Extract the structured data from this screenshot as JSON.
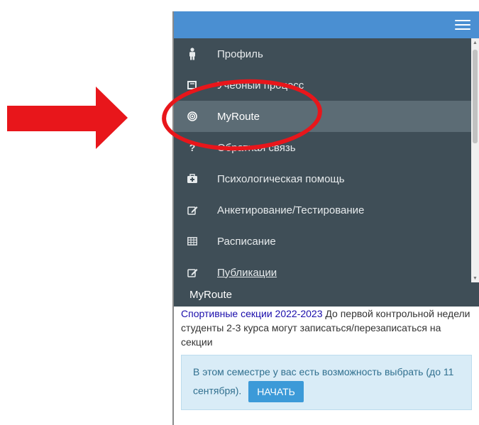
{
  "menu": {
    "items": [
      {
        "label": "Профиль",
        "icon": "person-icon",
        "active": false
      },
      {
        "label": "Учебный процесс",
        "icon": "book-icon",
        "active": false
      },
      {
        "label": "MyRoute",
        "icon": "target-icon",
        "active": true
      },
      {
        "label": "Обратная связь",
        "icon": "question-icon",
        "active": false
      },
      {
        "label": "Психологическая помощь",
        "icon": "medkit-icon",
        "active": false
      },
      {
        "label": "Анкетирование/Тестирование",
        "icon": "edit-icon",
        "active": false
      },
      {
        "label": "Расписание",
        "icon": "table-icon",
        "active": false
      },
      {
        "label": "Публикации",
        "icon": "edit-icon",
        "active": false
      }
    ]
  },
  "subheader": {
    "title": "MyRoute"
  },
  "content": {
    "link_text": "Спортивные секции 2022-2023",
    "text": " До первой контрольной недели студенты 2-3 курса могут записаться/перезаписаться на секции",
    "info_text": "В этом семестре у вас есть возможность выбрать (до 11 сентября).",
    "start_label": "НАЧАТЬ"
  },
  "colors": {
    "topbar": "#4a8fd2",
    "sidebar": "#3f4e57",
    "active_item": "#5c6c75",
    "annotation": "#e8161b",
    "info_bg": "#d9ecf7",
    "button": "#3c9ad8"
  }
}
